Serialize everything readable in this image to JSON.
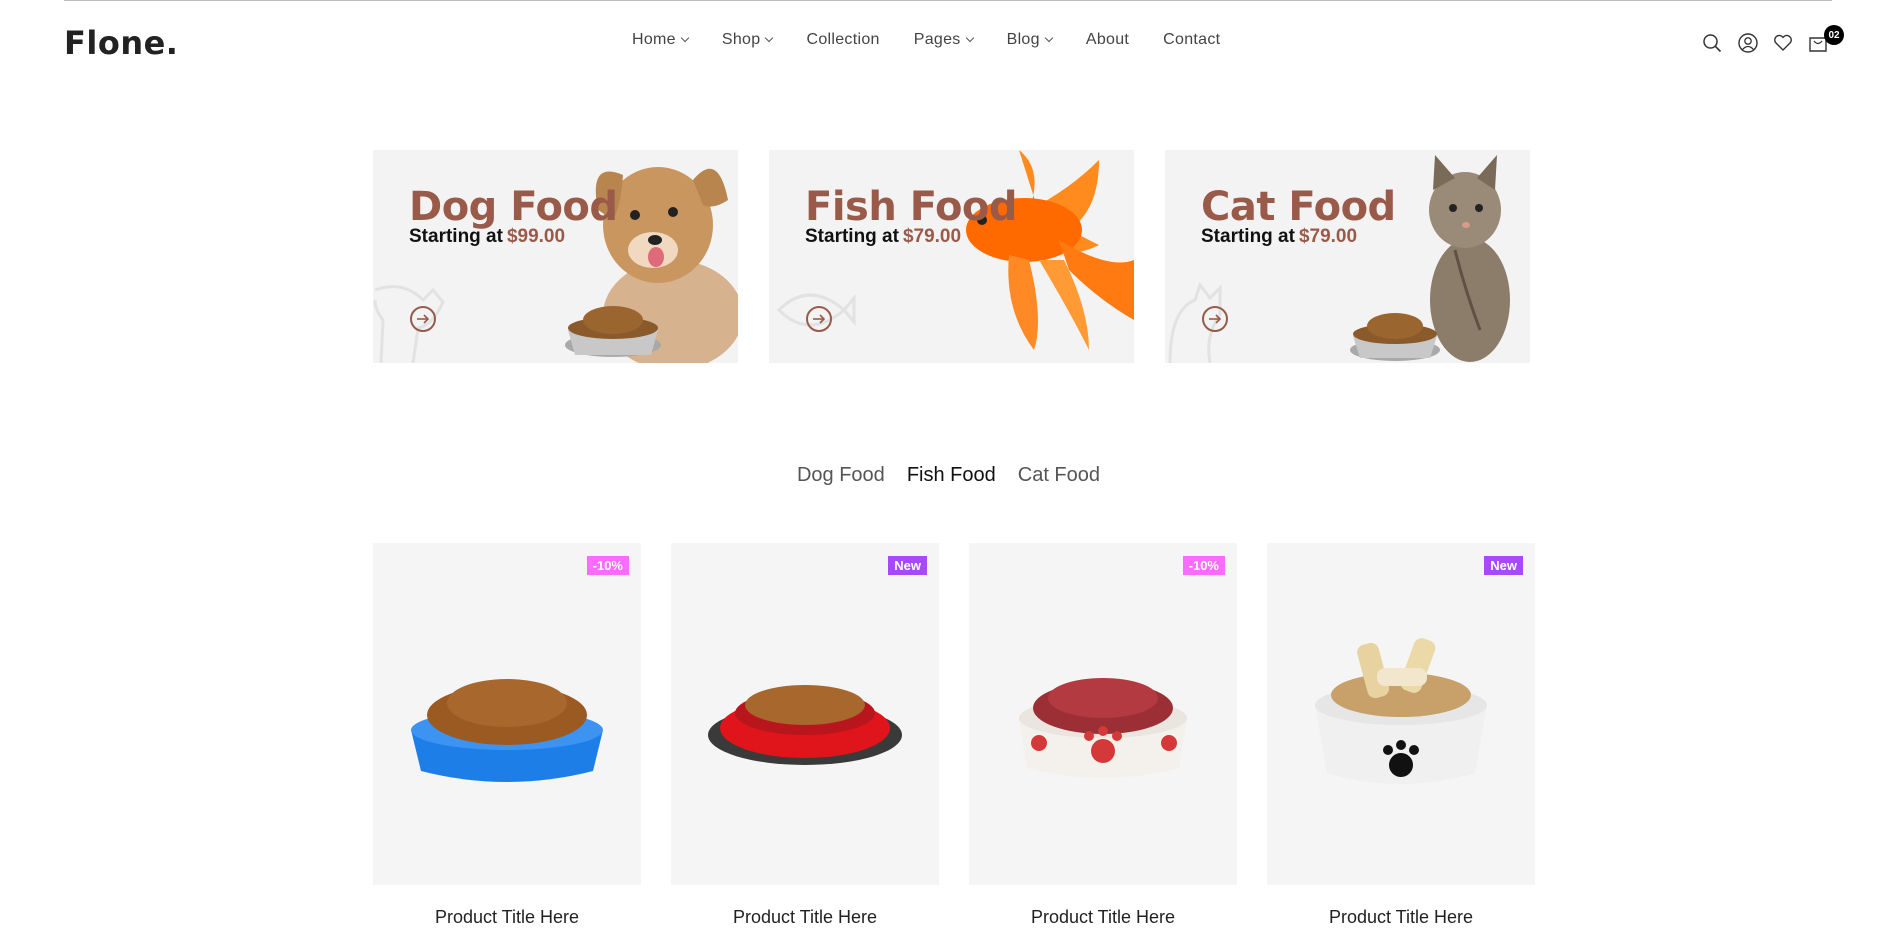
{
  "brand": {
    "logo": "Flone."
  },
  "nav": {
    "items": [
      {
        "label": "Home",
        "dropdown": true
      },
      {
        "label": "Shop",
        "dropdown": true
      },
      {
        "label": "Collection",
        "dropdown": false
      },
      {
        "label": "Pages",
        "dropdown": true
      },
      {
        "label": "Blog",
        "dropdown": true
      },
      {
        "label": "About",
        "dropdown": false
      },
      {
        "label": "Contact",
        "dropdown": false
      }
    ]
  },
  "header_icons": [
    "search-icon",
    "user-icon",
    "heart-icon",
    "cart-icon"
  ],
  "cart": {
    "count": "02"
  },
  "banners": [
    {
      "title": "Dog Food",
      "starting_text": "Starting at",
      "price": "$99.00"
    },
    {
      "title": "Fish Food",
      "starting_text": "Starting at",
      "price": "$79.00"
    },
    {
      "title": "Cat Food",
      "starting_text": "Starting at",
      "price": "$79.00"
    }
  ],
  "tabs": [
    {
      "label": "Dog Food",
      "active": false
    },
    {
      "label": "Fish Food",
      "active": true
    },
    {
      "label": "Cat Food",
      "active": false
    }
  ],
  "products": [
    {
      "title": "Product Title Here",
      "badge": "-10%"
    },
    {
      "title": "Product Title Here",
      "badge": "New"
    },
    {
      "title": "Product Title Here",
      "badge": "-10%"
    },
    {
      "title": "Product Title Here",
      "badge": "New"
    }
  ],
  "colors": {
    "accent_brown": "#9a5a49",
    "badge_sale": "#fa6bff",
    "badge_new": "#a749ff"
  }
}
